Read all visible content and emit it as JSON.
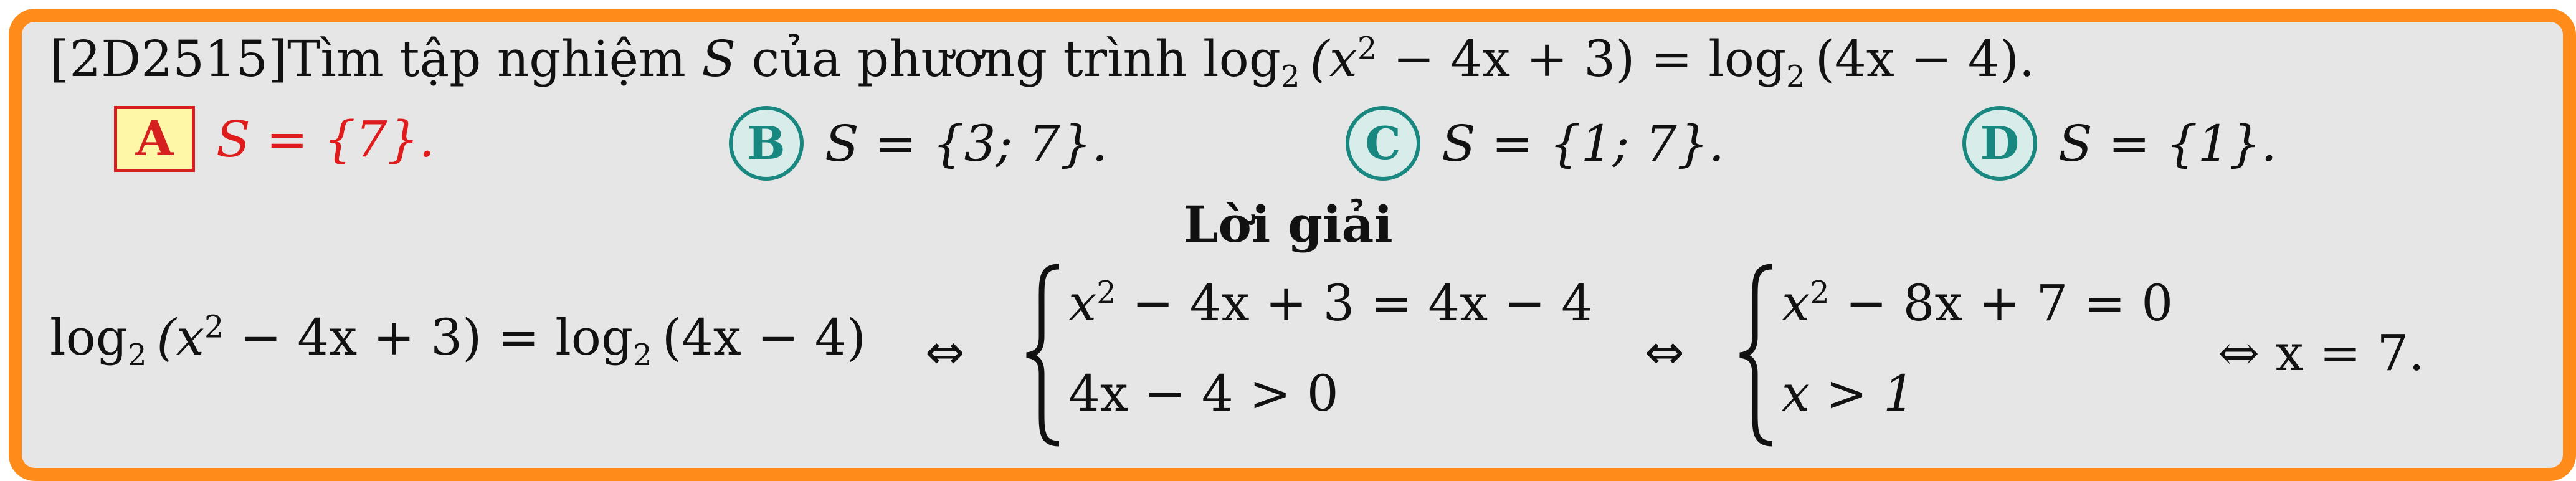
{
  "question": {
    "code": "[2D2515]",
    "text_before": "Tìm tập nghiệm ",
    "var": "S",
    "text_middle": " của phương trình ",
    "lhs_log": "log",
    "base": "2",
    "lhs_args": "(x",
    "exp": "2",
    "lhs_rest": " − 4x + 3) = ",
    "rhs_log": "log",
    "rhs_base": "2",
    "rhs_args": "(4x − 4)."
  },
  "options": [
    {
      "letter": "A",
      "text": "S = {7}.",
      "correct": true
    },
    {
      "letter": "B",
      "text": "S = {3; 7}.",
      "correct": false
    },
    {
      "letter": "C",
      "text": "S = {1; 7}.",
      "correct": false
    },
    {
      "letter": "D",
      "text": "S = {1}.",
      "correct": false
    }
  ],
  "solution": {
    "title": "Lời giải",
    "eq_log1": "log",
    "eq_base1": "2",
    "eq_arg1_pre": "(x",
    "eq_arg1_exp": "2",
    "eq_arg1_post": " − 4x + 3) = ",
    "eq_log2": "log",
    "eq_base2": "2",
    "eq_arg2": "(4x − 4)",
    "iff": "⇔",
    "sys1_l1_pre": "x",
    "sys1_l1_exp": "2",
    "sys1_l1_post": " − 4x + 3 = 4x − 4",
    "sys1_l2": "4x − 4 > 0",
    "sys2_l1_pre": "x",
    "sys2_l1_exp": "2",
    "sys2_l1_post": " − 8x + 7 = 0",
    "sys2_l2": "x > 1",
    "final": "⇔ x = 7."
  },
  "colors": {
    "border": "#ff8c1a",
    "background": "#e6e6e6",
    "correct": "#e01b1b",
    "option_circle": "#17877f",
    "answer_box_fill": "#fff7a8"
  }
}
